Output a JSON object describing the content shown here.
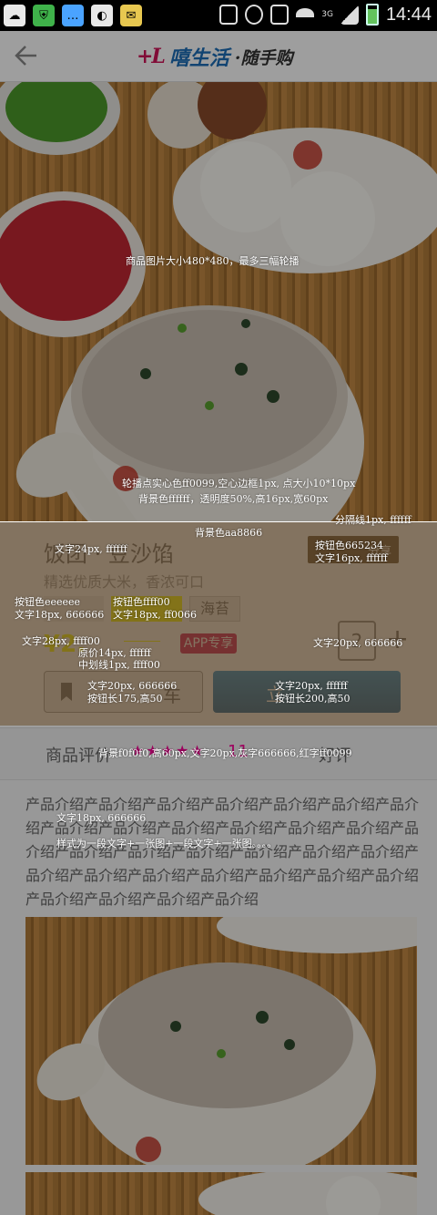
{
  "status_bar": {
    "time": "14:44",
    "network": "3G"
  },
  "header": {
    "brand_logo": "+L",
    "brand_name": "嘻生活",
    "brand_suffix": "·随手购"
  },
  "annotations": {
    "hero": "商品图片大小480*480，最多三幅轮播",
    "dots": "轮播点实心色ff0099,空心边框1px, 点大小10*10px",
    "dots_bg": "背景色ffffff，透明度50%,高16px,宽60px",
    "panel_bg": "背景色aa8866",
    "separator": "分隔线1px, ffffff",
    "title": "文字24px, ffffff",
    "share_btn": "按钮色665234",
    "share_text": "文字16px, ffffff",
    "tag1_color": "按钮色eeeeee",
    "tag1_text": "文字18px, 666666",
    "tag2_color": "按钮色ffff00",
    "tag2_text": "文字18px, ff0066",
    "price": "文字28px, ffff00",
    "orig_price": "原价14px, ffffff",
    "strike": "中划线1px, ffff00",
    "qty": "文字20px, 666666",
    "fav_text": "文字20px, 666666",
    "fav_size": "按钮长175,高50",
    "buy_text": "文字20px, ffffff",
    "buy_size": "按钮长200,高50",
    "reviews": "背景f0f0f0,高60px,文字20px,灰字666666,红字ff0099",
    "desc_font": "文字18px, 666666",
    "desc_style": "样式为一段文字+一张图+一段文字+一张图。。。。"
  },
  "product": {
    "title": "饭团 · 豆沙馅",
    "subtitle": "精选优质大米，香浓可口",
    "share": "分享",
    "tags": [
      "",
      "",
      "海苔"
    ],
    "price": "¥2.",
    "orig_price": "¥6.00",
    "app_badge": "APP专享",
    "quantity": "2",
    "plus": "+",
    "fav_label": "车",
    "buy_label": "立"
  },
  "reviews": {
    "label": "商品评价",
    "stars": "★★★★★",
    "count": "11",
    "good_rate": "好评"
  },
  "description": {
    "text": "产品介绍产品介绍产品介绍产品介绍产品介绍产品介绍产品介绍产品介绍产品介绍产品介绍产品介绍产品介绍产品介绍产品介绍产品介绍产品介绍产品介绍产品介绍产品介绍产品介绍产品介绍产品介绍产品介绍产品介绍产品介绍产品介绍产品介绍产品介绍产品介绍产品介绍产品介绍"
  },
  "colors": {
    "accent": "#ff0099",
    "brand_red": "#d1145a",
    "brand_blue": "#1d6fb8",
    "buy": "#0c5c9a"
  }
}
